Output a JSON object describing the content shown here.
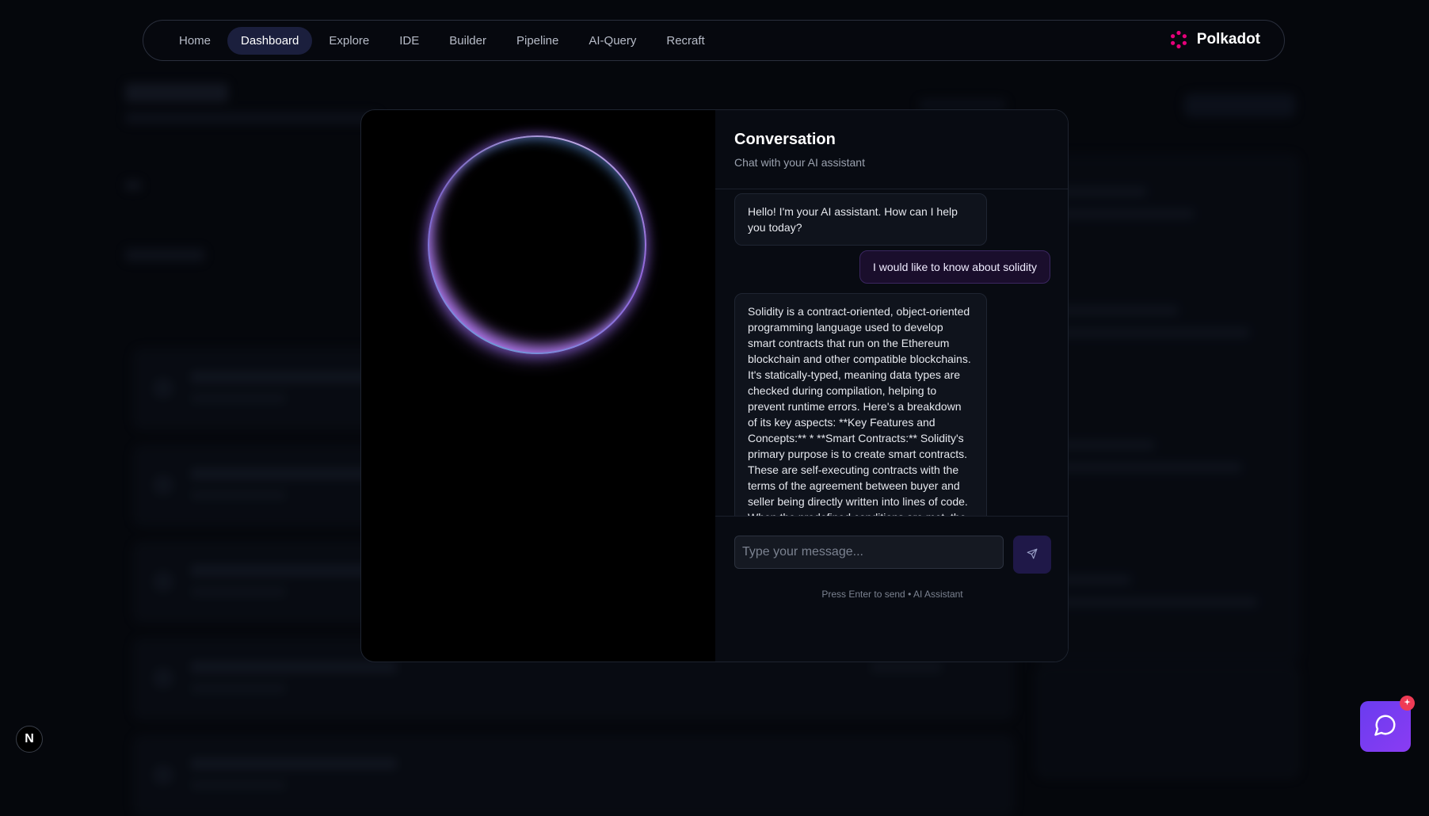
{
  "nav": {
    "items": [
      "Home",
      "Dashboard",
      "Explore",
      "IDE",
      "Builder",
      "Pipeline",
      "AI-Query",
      "Recraft"
    ],
    "active": "Dashboard",
    "brand": "Polkadot",
    "brand_color": "#e6007a"
  },
  "chat": {
    "title": "Conversation",
    "subtitle": "Chat with your AI assistant",
    "messages": [
      {
        "role": "assistant",
        "text": "Hello! I'm your AI assistant. How can I help you today?"
      },
      {
        "role": "user",
        "text": "I would like to know about solidity"
      },
      {
        "role": "assistant",
        "text": "Solidity is a contract-oriented, object-oriented programming language used to develop smart contracts that run on the Ethereum blockchain and other compatible blockchains. It's statically-typed, meaning data types are checked during compilation, helping to prevent runtime errors. Here's a breakdown of its key aspects: **Key Features and Concepts:** * **Smart Contracts:** Solidity's primary purpose is to create smart contracts. These are self-executing contracts with the terms of the agreement between buyer and seller being directly written into lines of code. When the predefined conditions are met, the contract automatically"
      }
    ],
    "input_placeholder": "Type your message...",
    "input_value": "",
    "hint": "Press Enter to send • AI Assistant",
    "send_icon": "send-icon"
  },
  "overlay": {
    "n_label": "N",
    "fab_icon": "chat-bubble-icon",
    "badge_icon": "sparkle-icon"
  },
  "colors": {
    "accent": "#6a3cf0",
    "user_bubble": "#1a0e2c",
    "badge": "#ef3b55"
  }
}
